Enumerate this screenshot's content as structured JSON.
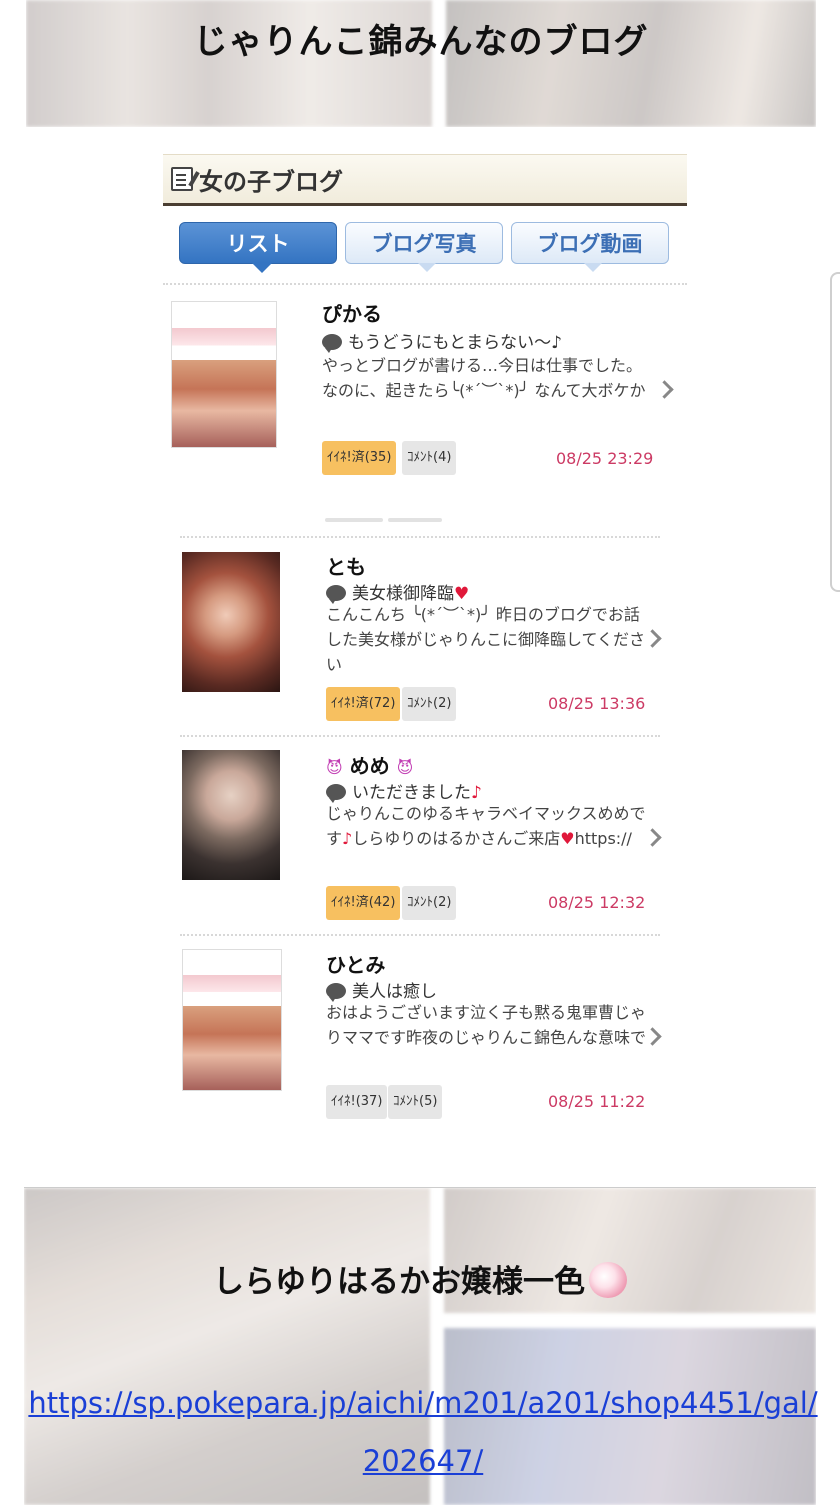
{
  "header": {
    "banner_title": "じゃりんこ錦みんなのブログ"
  },
  "module": {
    "title": "女の子ブログ",
    "tabs": [
      {
        "label": "リスト",
        "active": true
      },
      {
        "label": "ブログ写真",
        "active": false
      },
      {
        "label": "ブログ動画",
        "active": false
      }
    ]
  },
  "entries": [
    {
      "name": "ぴかる",
      "subject": "もうどうにもとまらない〜♪",
      "excerpt": "やっとブログが書ける…今日は仕事でした。なのに、起きたら╰(*´︶`*)╯ なんて大ボケか",
      "like_label": "ｲｲﾈ!済(35)",
      "comment_label": "ｺﾒﾝﾄ(4)",
      "date": "08/25 23:29"
    },
    {
      "name": "とも",
      "subject": "美女様御降臨",
      "subject_icon": "heart-icon",
      "excerpt": "こんこんち ╰(*´︶`*)╯ 昨日のブログでお話した美女様がじゃりんこに御降臨してください",
      "like_label": "ｲｲﾈ!済(72)",
      "comment_label": "ｺﾒﾝﾄ(2)",
      "date": "08/25 13:36"
    },
    {
      "name": "めめ",
      "name_icon": "devil-face-icon",
      "subject": "いただきました",
      "subject_icon": "music-note-icon",
      "excerpt_parts": [
        "じゃりんこのゆるキャラベイマックスめめです",
        "しらゆりのはるかさんご来店",
        "https://"
      ],
      "like_label": "ｲｲﾈ!済(42)",
      "comment_label": "ｺﾒﾝﾄ(2)",
      "date": "08/25 12:32"
    },
    {
      "name": "ひとみ",
      "subject": "美人は癒し",
      "excerpt": "おはようございます泣く子も黙る鬼軍曹じゃりママです昨夜のじゃりんこ錦色んな意味で",
      "like_label": "ｲｲﾈ!(37)",
      "comment_label": "ｺﾒﾝﾄ(5)",
      "date": "08/25 11:22"
    }
  ],
  "glyphs": {
    "heart": "♥",
    "note": "♪",
    "devil_face": "😈"
  },
  "footer": {
    "title": "しらゆりはるかお嬢様一色",
    "link": "https://sp.pokepara.jp/aichi/m201/a201/shop4451/gal/202647/"
  },
  "colors": {
    "tab_active": "#3474c2",
    "like_badge": "#f7c060",
    "date_text": "#cc3a64",
    "link": "#1a3fd6"
  }
}
